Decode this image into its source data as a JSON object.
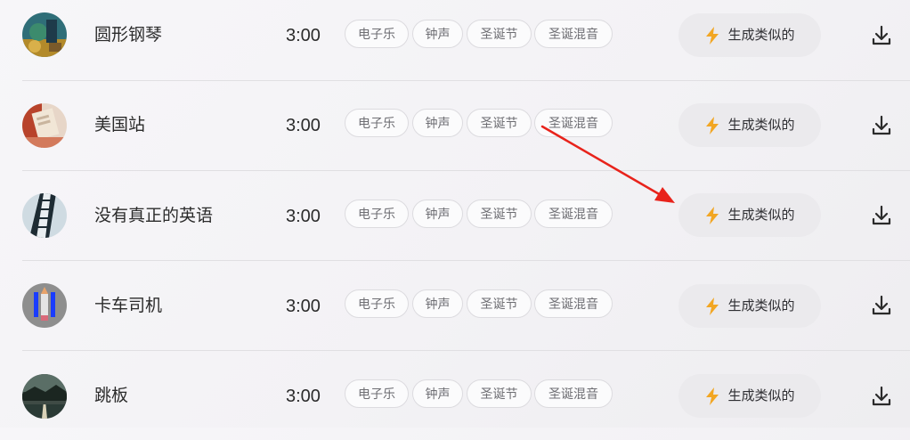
{
  "tracks": [
    {
      "title": "圆形钢琴",
      "duration": "3:00",
      "tags": [
        "电子乐",
        "钟声",
        "圣诞节",
        "圣诞混音"
      ],
      "generate_label": "生成类似的",
      "thumb_icon": "album-art-painting"
    },
    {
      "title": "美国站",
      "duration": "3:00",
      "tags": [
        "电子乐",
        "钟声",
        "圣诞节",
        "圣诞混音"
      ],
      "generate_label": "生成类似的",
      "thumb_icon": "album-art-book"
    },
    {
      "title": "没有真正的英语",
      "duration": "3:00",
      "tags": [
        "电子乐",
        "钟声",
        "圣诞节",
        "圣诞混音"
      ],
      "generate_label": "生成类似的",
      "thumb_icon": "album-art-building"
    },
    {
      "title": "卡车司机",
      "duration": "3:00",
      "tags": [
        "电子乐",
        "钟声",
        "圣诞节",
        "圣诞混音"
      ],
      "generate_label": "生成类似的",
      "thumb_icon": "album-art-pencil"
    },
    {
      "title": "跳板",
      "duration": "3:00",
      "tags": [
        "电子乐",
        "钟声",
        "圣诞节",
        "圣诞混音"
      ],
      "generate_label": "生成类似的",
      "thumb_icon": "album-art-landscape"
    }
  ],
  "colors": {
    "bolt": "#f2a623",
    "arrow": "#e8231b",
    "tag_text": "#6e6e73",
    "button_bg": "#ebeaed"
  }
}
